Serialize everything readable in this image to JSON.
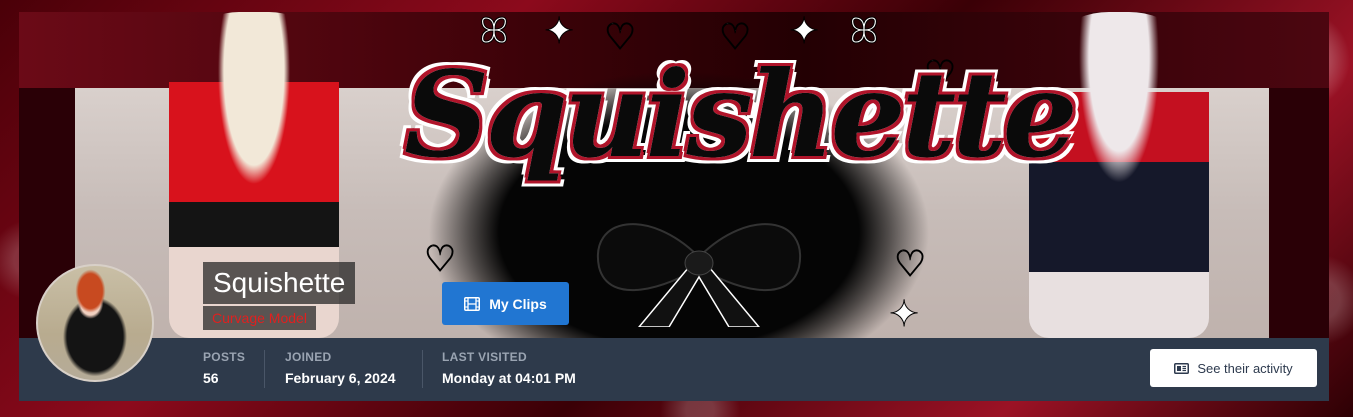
{
  "profile": {
    "username": "Squishette",
    "user_title": "Curvage Model",
    "banner_logo_text": "Squishette",
    "clips_button": {
      "label": "My Clips",
      "icon": "film-icon"
    },
    "stats": [
      {
        "label": "POSTS",
        "value": "56"
      },
      {
        "label": "JOINED",
        "value": "February 6, 2024"
      },
      {
        "label": "LAST VISITED",
        "value": "Monday at 04:01 PM"
      }
    ],
    "activity_button": {
      "label": "See their activity",
      "icon": "newspaper-icon"
    }
  },
  "colors": {
    "accent_blue": "#2176d2",
    "info_bar": "#2e3a4b",
    "user_title_red": "#e0201f",
    "background_red": "#8c0a1c"
  }
}
